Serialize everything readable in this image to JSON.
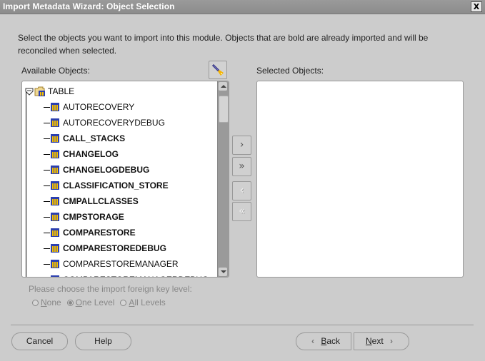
{
  "window": {
    "title": "Import Metadata Wizard: Object Selection",
    "close_label": "X"
  },
  "instructions": "Select the objects you want to import into this module. Objects that are bold are already imported and will be reconciled when selected.",
  "available": {
    "label": "Available Objects:",
    "find_icon": "flashlight-icon",
    "root": {
      "label": "TABLE",
      "expanded": true
    },
    "items": [
      {
        "label": "AUTORECOVERY",
        "bold": false
      },
      {
        "label": "AUTORECOVERYDEBUG",
        "bold": false
      },
      {
        "label": "CALL_STACKS",
        "bold": true
      },
      {
        "label": "CHANGELOG",
        "bold": true
      },
      {
        "label": "CHANGELOGDEBUG",
        "bold": true
      },
      {
        "label": "CLASSIFICATION_STORE",
        "bold": true
      },
      {
        "label": "CMPALLCLASSES",
        "bold": true
      },
      {
        "label": "CMPSTORAGE",
        "bold": true
      },
      {
        "label": "COMPARESTORE",
        "bold": true
      },
      {
        "label": "COMPARESTOREDEBUG",
        "bold": true
      },
      {
        "label": "COMPARESTOREMANAGER",
        "bold": false
      },
      {
        "label": "COMPARESTOREMANAGERDEBUG",
        "bold": false
      }
    ]
  },
  "move_buttons": {
    "add": "›",
    "add_all": "»",
    "remove": "‹",
    "remove_all": "«"
  },
  "selected": {
    "label": "Selected Objects:",
    "items": []
  },
  "foreign_key": {
    "label": "Please choose the import foreign key level:",
    "options": [
      {
        "label": "None",
        "mnemonic": "N",
        "rest": "one",
        "selected": false
      },
      {
        "label": "One Level",
        "mnemonic": "O",
        "rest": "ne Level",
        "selected": true
      },
      {
        "label": "All Levels",
        "mnemonic": "A",
        "rest": "ll Levels",
        "selected": false
      }
    ]
  },
  "footer": {
    "cancel": "Cancel",
    "help": "Help",
    "back_mnemonic": "B",
    "back_rest": "ack",
    "next_mnemonic": "N",
    "next_rest": "ext"
  }
}
